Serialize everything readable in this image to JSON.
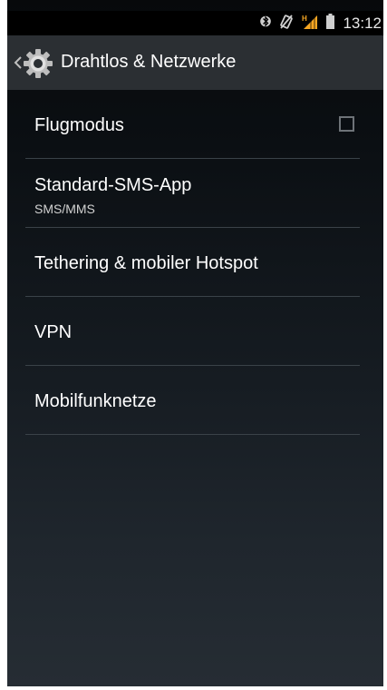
{
  "status_bar": {
    "time": "13:12",
    "icons": [
      "bluetooth-icon",
      "vibrate-mute-icon",
      "signal-hspa-icon",
      "battery-icon"
    ],
    "network_type": "H"
  },
  "action_bar": {
    "title": "Drahtlos & Netzwerke",
    "icon": "settings-gear-icon"
  },
  "settings": [
    {
      "title": "Flugmodus",
      "summary": "",
      "has_checkbox": true,
      "checked": false
    },
    {
      "title": "Standard-SMS-App",
      "summary": "SMS/MMS"
    },
    {
      "title": "Tethering & mobiler Hotspot",
      "summary": ""
    },
    {
      "title": "VPN",
      "summary": ""
    },
    {
      "title": "Mobilfunknetze",
      "summary": ""
    }
  ],
  "colors": {
    "action_bar_bg": "#2b2f33",
    "divider": "#3a4248",
    "signal_accent": "#f5a623",
    "text_primary": "#ffffff"
  }
}
